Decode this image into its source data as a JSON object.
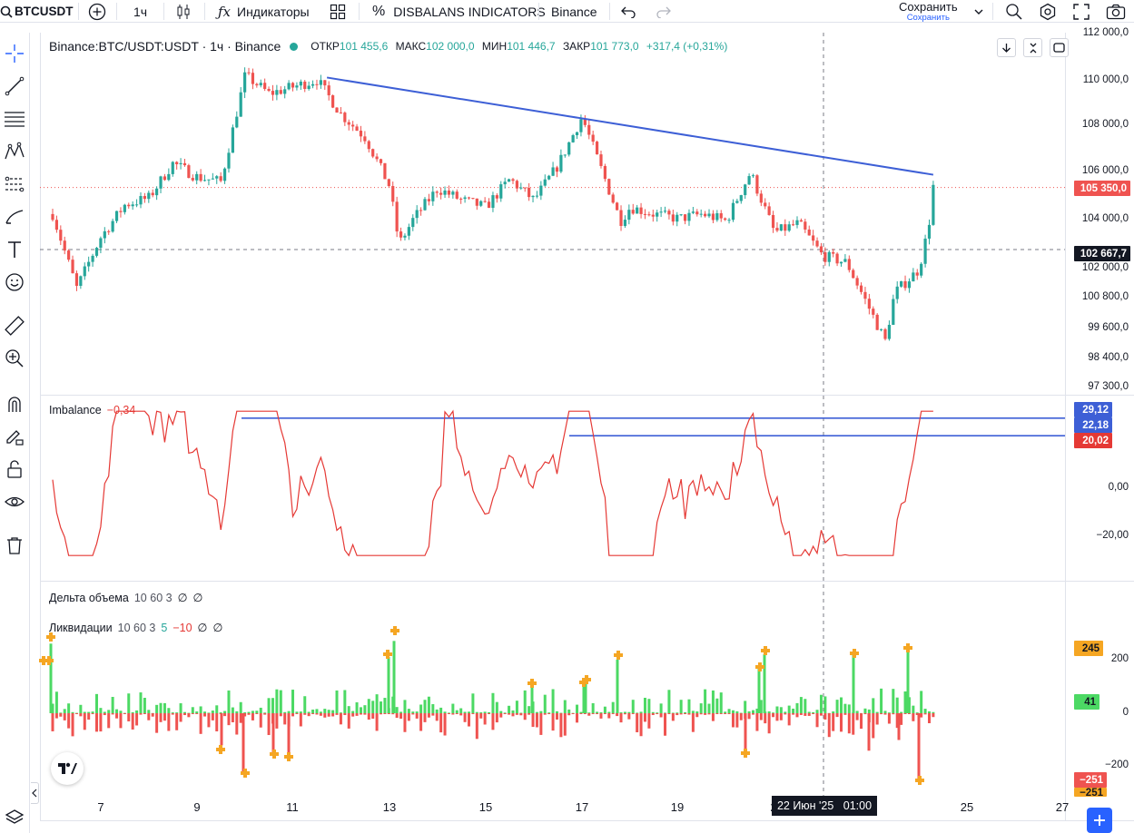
{
  "topbar": {
    "symbol": "BTCUSDT",
    "timeframe": "1ч",
    "indicators_label": "Индикаторы",
    "script_label": "DISBALANS INDICATORS",
    "exchange_label": "Binance",
    "save_label": "Сохранить",
    "save_status": "Сохранить"
  },
  "legend": {
    "title": "Binance:BTC/USDT:USDT · 1ч · Binance",
    "open_label": "ОТКР",
    "open_value": "101 455,6",
    "high_label": "МАКС",
    "high_value": "102 000,0",
    "low_label": "МИН",
    "low_value": "101 446,7",
    "close_label": "ЗАКР",
    "close_value": "101 773,0",
    "change": "+317,4 (+0,31%)"
  },
  "imbalance": {
    "name": "Imbalance",
    "value": "−0,34"
  },
  "delta": {
    "name": "Дельта объема",
    "params": "10 60 3",
    "v1": "∅",
    "v2": "∅"
  },
  "liq": {
    "name": "Ликвидации",
    "params": "10 60 3",
    "pos": "5",
    "neg": "−10",
    "v1": "∅",
    "v2": "∅"
  },
  "price_axis": [
    "112 000,0",
    "110 000,0",
    "108 000,0",
    "106 000,0",
    "104 000,0",
    "102 000,0",
    "100 800,0",
    "99 600,0",
    "98 400,0",
    "97 300,0"
  ],
  "price_tags": {
    "last": "105 350,0",
    "crosshair": "102 667,7"
  },
  "imb_axis": [
    "0,00",
    "−20,00"
  ],
  "imb_tags": {
    "a": "29,12",
    "b": "22,18",
    "c": "20,02"
  },
  "liq_axis": [
    "200",
    "0",
    "−200"
  ],
  "liq_tags": {
    "a": "245",
    "b": "41",
    "c": "−251",
    "d": "−251"
  },
  "time_axis": [
    "7",
    "9",
    "11",
    "13",
    "15",
    "17",
    "19",
    "2",
    "25",
    "27"
  ],
  "crosshair_time": "22 Июн '25   01:00",
  "colors": {
    "up": "#26a69a",
    "down": "#ef5350",
    "line": "#3d5fd6",
    "imb": "#e53935",
    "orange": "#f5a623",
    "green": "#4cd964"
  },
  "chart_data": [
    {
      "type": "candlestick",
      "title": "Binance:BTC/USDT:USDT · 1ч · Binance",
      "ylim": [
        97300,
        112000
      ],
      "x_ticks": [
        "7",
        "9",
        "11",
        "13",
        "15",
        "17",
        "19",
        "25",
        "27"
      ],
      "close_path": [
        [
          "6",
          104200
        ],
        [
          "6.5",
          101000
        ],
        [
          "7",
          103200
        ],
        [
          "7.5",
          104600
        ],
        [
          "8",
          104900
        ],
        [
          "8.5",
          106400
        ],
        [
          "9",
          105800
        ],
        [
          "9.5",
          105600
        ],
        [
          "10",
          110200
        ],
        [
          "10.5",
          109400
        ],
        [
          "11",
          109700
        ],
        [
          "11.5",
          110000
        ],
        [
          "12",
          108500
        ],
        [
          "12.5",
          107500
        ],
        [
          "13",
          105400
        ],
        [
          "13.2",
          102900
        ],
        [
          "13.5",
          104000
        ],
        [
          "14",
          105300
        ],
        [
          "14.5",
          104800
        ],
        [
          "15",
          104500
        ],
        [
          "15.5",
          105700
        ],
        [
          "16",
          104800
        ],
        [
          "16.5",
          106300
        ],
        [
          "17",
          108400
        ],
        [
          "17.3",
          106700
        ],
        [
          "17.8",
          103900
        ],
        [
          "18",
          104500
        ],
        [
          "18.5",
          104200
        ],
        [
          "19",
          104000
        ],
        [
          "19.5",
          104200
        ],
        [
          "20",
          103900
        ],
        [
          "20.5",
          106000
        ],
        [
          "21",
          103400
        ],
        [
          "21.5",
          103800
        ],
        [
          "22",
          102400
        ],
        [
          "22.5",
          102100
        ],
        [
          "23",
          100000
        ],
        [
          "23.3",
          98700
        ],
        [
          "23.5",
          100800
        ],
        [
          "24",
          101800
        ],
        [
          "24.2",
          103600
        ],
        [
          "24.3",
          105400
        ]
      ],
      "trendline": [
        [
          "11.7",
          110100
        ],
        [
          "24.3",
          105900
        ]
      ],
      "last_price": 105350,
      "crosshair_price": 102667.7
    },
    {
      "type": "line",
      "series": [
        {
          "name": "Imbalance"
        }
      ],
      "ylim": [
        -30,
        35
      ],
      "levels": [
        29.12,
        22.18,
        20.02
      ],
      "y_ticks": [
        0,
        -20
      ]
    },
    {
      "type": "bar",
      "series": [
        {
          "name": "Ликвидации"
        }
      ],
      "ylim": [
        -310,
        280
      ],
      "y_ticks": [
        200,
        0,
        -200
      ],
      "labels": [
        245,
        41,
        -251
      ]
    }
  ]
}
